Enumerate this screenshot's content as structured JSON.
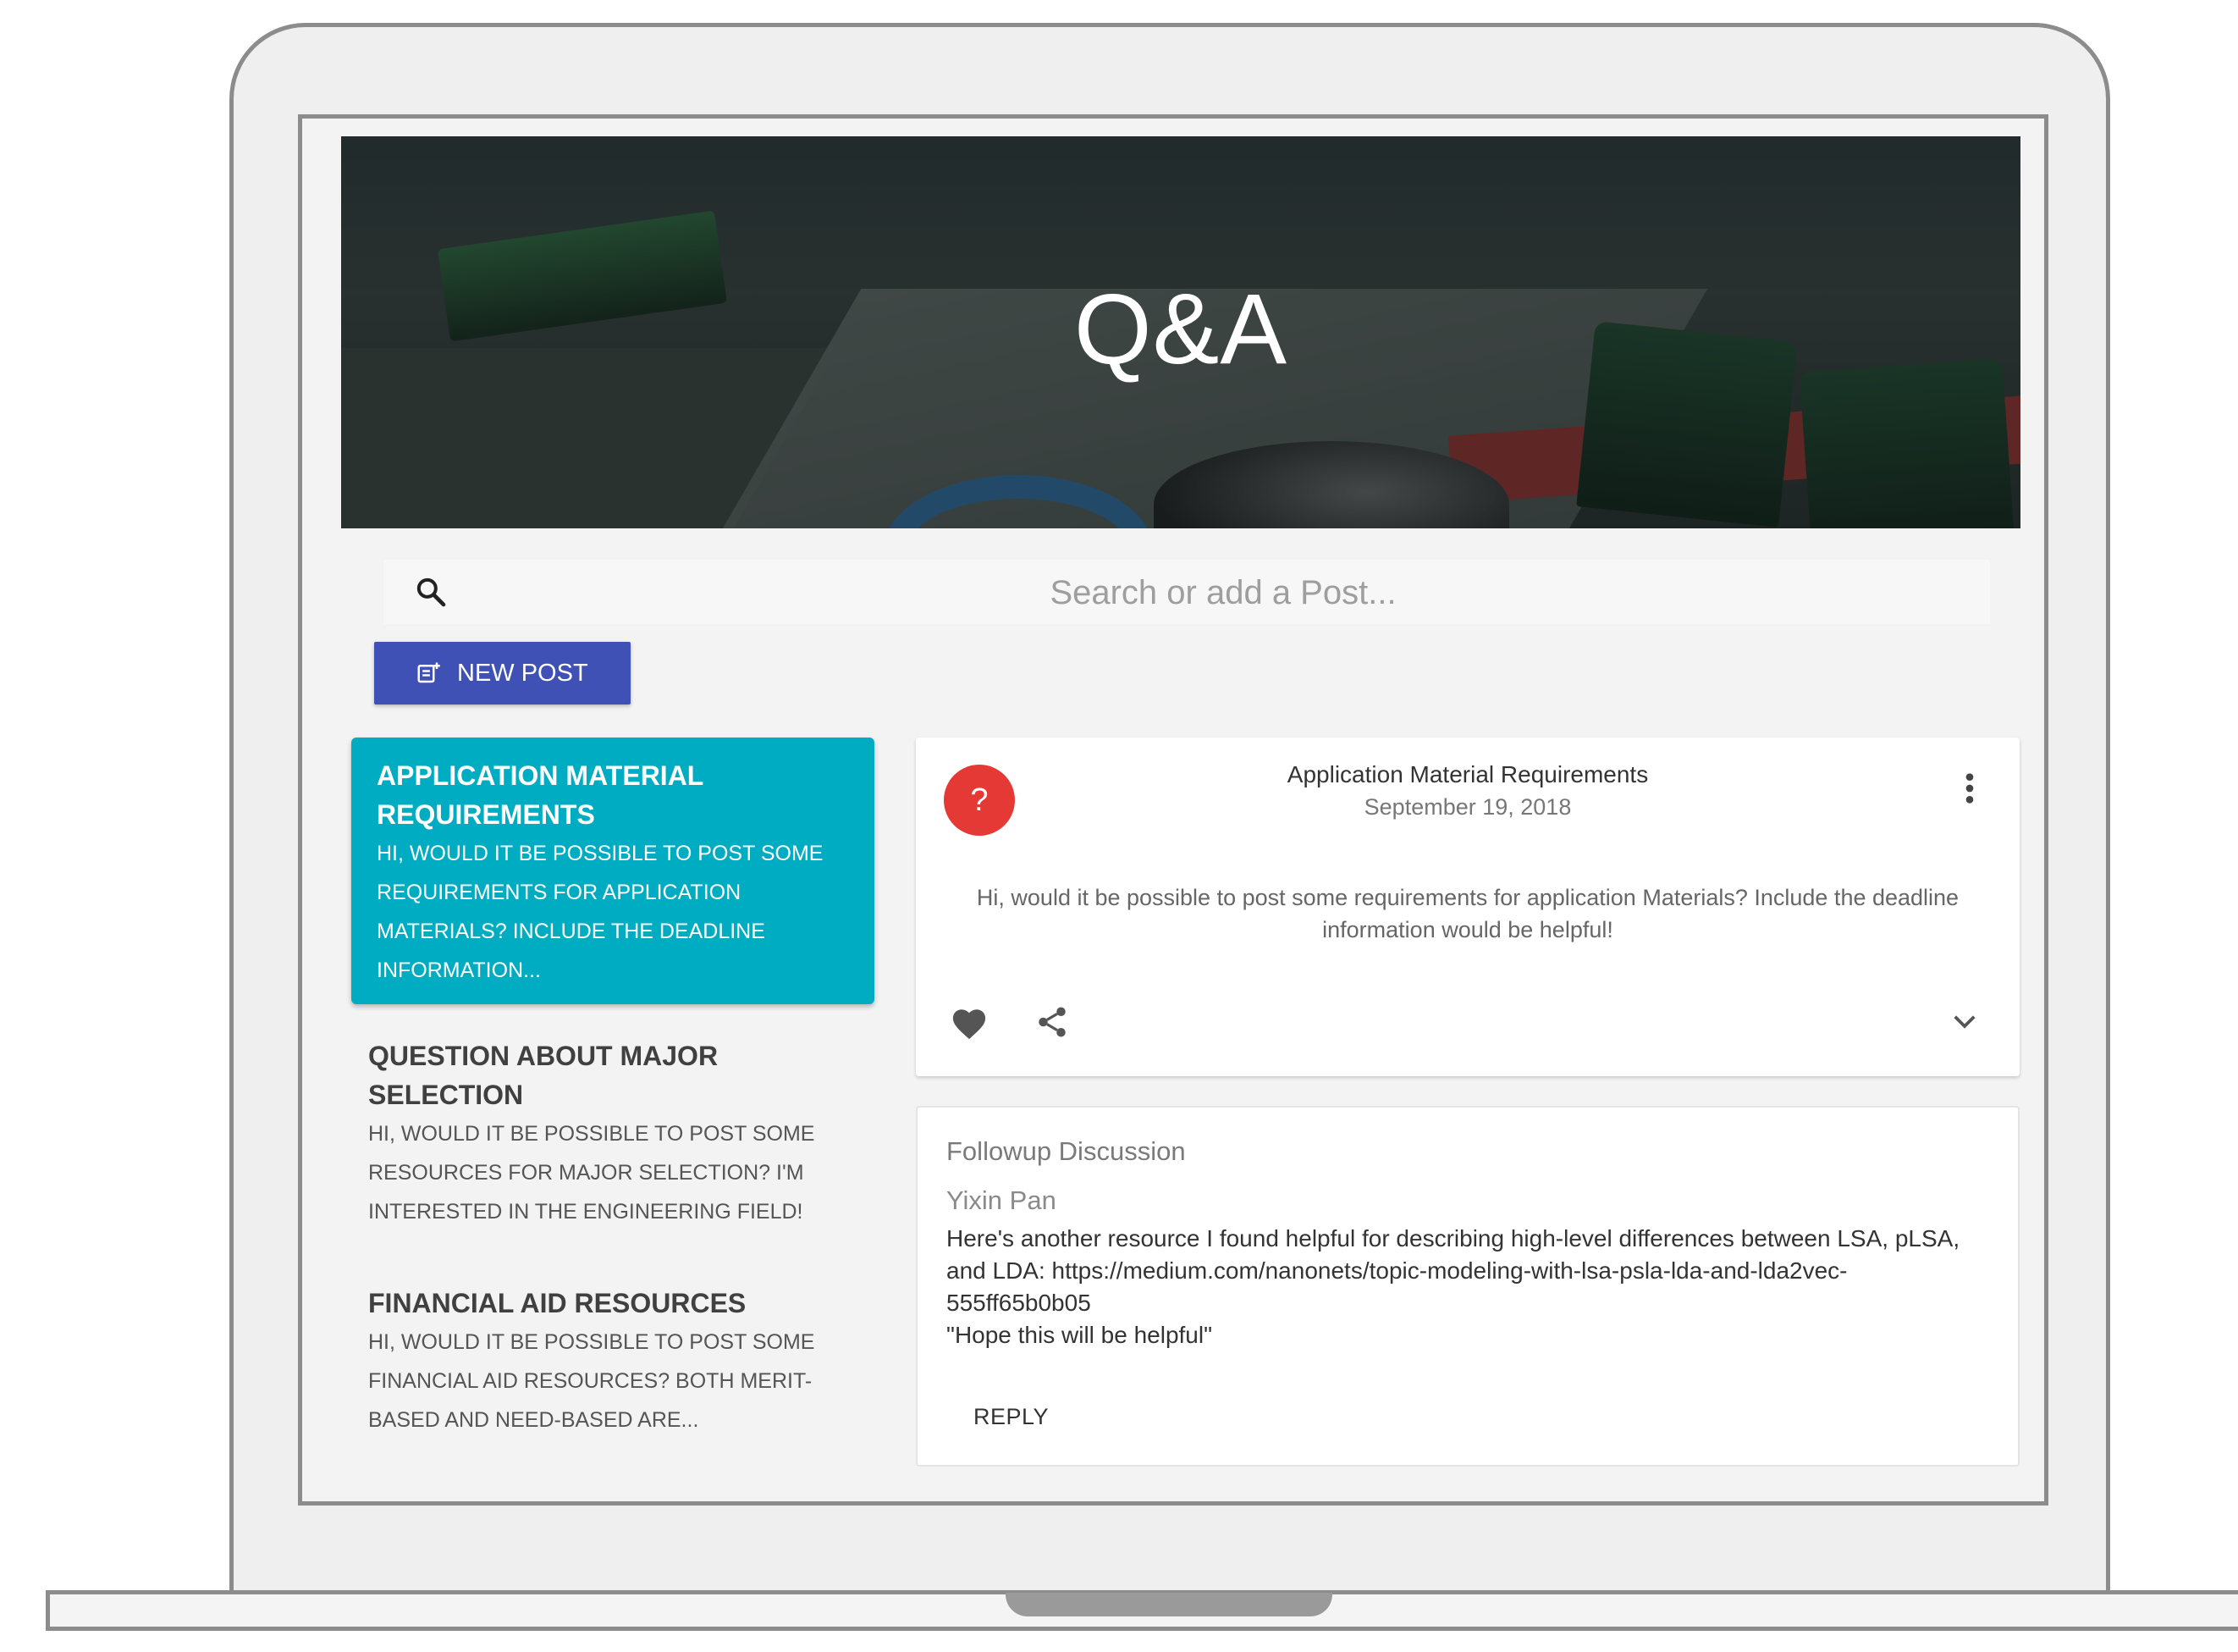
{
  "hero": {
    "title": "Q&A"
  },
  "search": {
    "placeholder": "Search or add a Post..."
  },
  "toolbar": {
    "new_post_label": "NEW POST"
  },
  "posts": [
    {
      "title": "Application Material Requirements",
      "excerpt": "Hi, would it be possible to post some requirements for application Materials? Include the deadline information...",
      "active": true
    },
    {
      "title": "Question about Major Selection",
      "excerpt": "Hi, would it be possible to post some resources for major selection? I'm interested in the engineering field!",
      "active": false
    },
    {
      "title": "Financial Aid Resources",
      "excerpt": "Hi, would it be possible to post some financial aid resources? Both merit-based and need-based are...",
      "active": false
    }
  ],
  "detail": {
    "avatar": "?",
    "title": "Application Material Requirements",
    "date": "September 19, 2018",
    "body": "Hi, would it be possible to post some requirements for application Materials? Include the deadline information would be helpful!",
    "icons": [
      "heart-icon",
      "share-icon",
      "chevron-down-icon",
      "more-vert-icon"
    ]
  },
  "followup": {
    "heading": "Followup Discussion",
    "author": "Yixin Pan",
    "body": "Here's another resource I found helpful for describing high-level differences between LSA, pLSA, and LDA:  https://medium.com/nanonets/topic-modeling-with-lsa-psla-lda-and-lda2vec-555ff65b0b05\n\"Hope this will be helpful\"",
    "reply_label": "REPLY"
  },
  "colors": {
    "primary_button": "#3f51b5",
    "active_post": "#00acc1",
    "question_avatar": "#e53935"
  }
}
